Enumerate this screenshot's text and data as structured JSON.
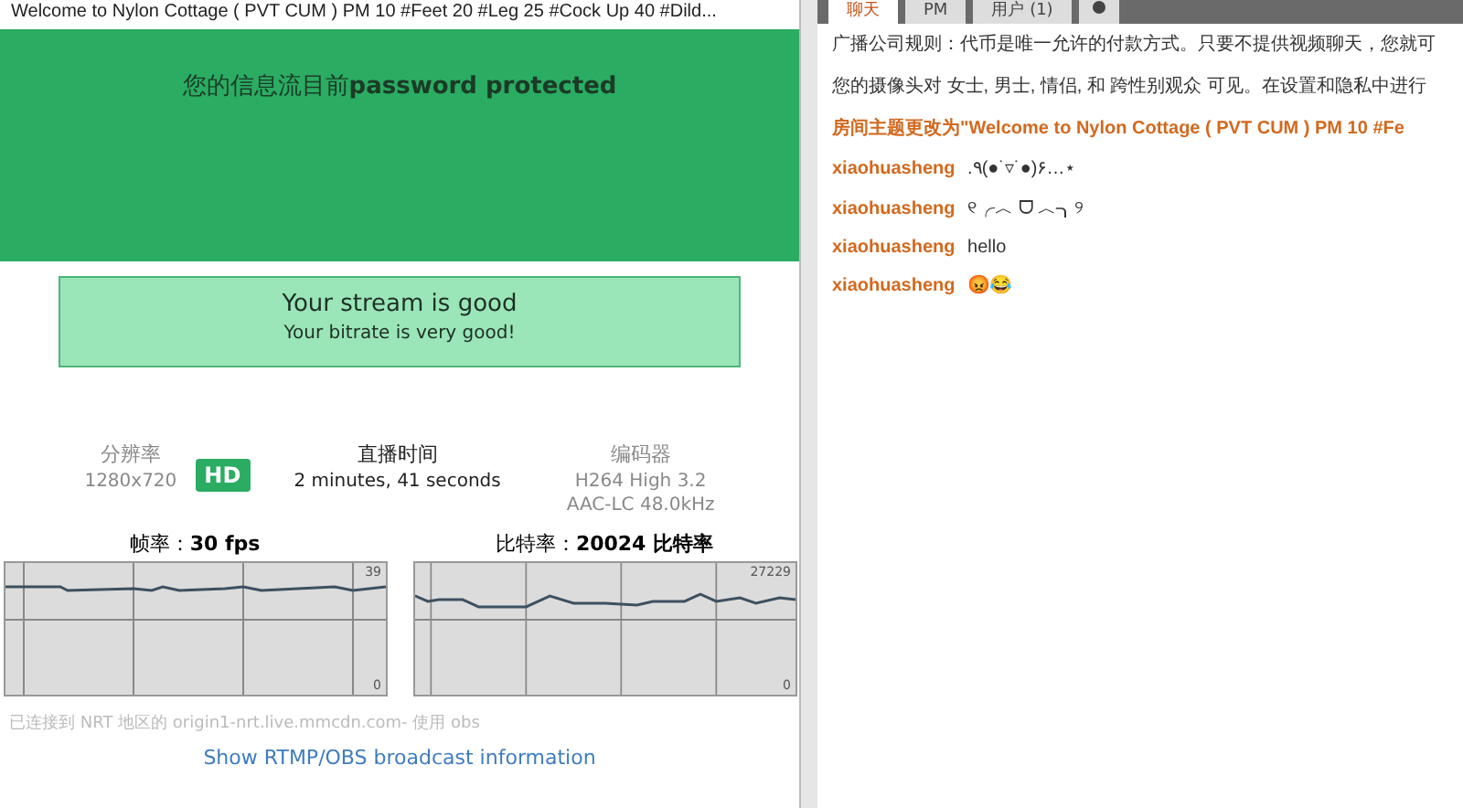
{
  "room_title": "Welcome to Nylon Cottage ( PVT CUM ) PM 10 #Feet 20 #Leg 25 #Cock Up 40 #Dild...",
  "banner": {
    "text": "您的信息流目前**password protected**"
  },
  "stream_status": {
    "title": "Your stream is good",
    "subtitle": "Your bitrate is very good!"
  },
  "stats": {
    "resolution_label": "分辨率",
    "resolution": "1280x720",
    "hd_badge": "HD",
    "time_label": "直播时间",
    "time": "2 minutes, 41 seconds",
    "encoder_label": "编码器",
    "video_codec": "H264 High 3.2",
    "audio_codec": "AAC-LC 48.0kHz"
  },
  "graphs": [
    {
      "title": "帧率：**30 fps**",
      "max": "39",
      "min": "0",
      "kind": "flat"
    },
    {
      "title": "比特率：**20024 比特率**",
      "max": "27229",
      "min": "0",
      "kind": "wavy"
    }
  ],
  "connection": "已连接到 NRT 地区的 origin1-nrt.live.mmcdn.com- 使用 obs",
  "broadcast_link": "Show RTMP/OBS broadcast information",
  "tabs": [
    {
      "label": "聊天",
      "selected": true
    },
    {
      "label": "PM",
      "selected": false
    },
    {
      "label": "用户 (1)",
      "selected": false
    }
  ],
  "messages": [
    {
      "kind": "notice",
      "text": "广播公司规则：代币是唯一允许的付款方式。只要不提供视频聊天，您就可"
    },
    {
      "kind": "notice",
      "text": "您的摄像头对 女士, 男士, 情侣, 和 跨性别观众 可见。在设置和隐私中进行"
    },
    {
      "kind": "topic",
      "text": "房间主题更改为\"Welcome to Nylon Cottage ( PVT CUM ) PM 10 #Fe"
    },
    {
      "kind": "chat",
      "user": "xiaohuasheng",
      "text": ".٩(●˙▿˙●)۶…⋆"
    },
    {
      "kind": "chat",
      "user": "xiaohuasheng",
      "text": "୧╭︿ ᗜ ︿╮୨"
    },
    {
      "kind": "chat",
      "user": "xiaohuasheng",
      "text": "hello"
    },
    {
      "kind": "chat",
      "user": "xiaohuasheng",
      "text": "😡😂"
    }
  ]
}
